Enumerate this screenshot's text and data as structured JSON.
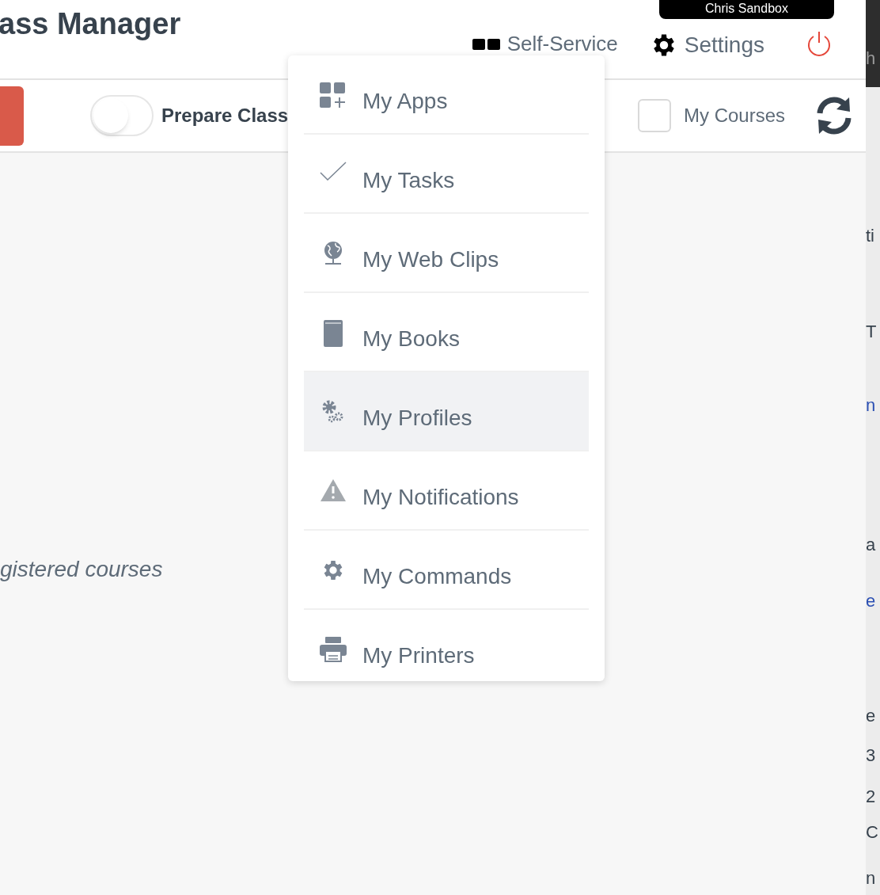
{
  "header": {
    "title": "ass Manager",
    "account_badge": "Chris Sandbox",
    "self_service": "Self-Service",
    "settings": "Settings"
  },
  "toolbar": {
    "prepare_class": {
      "label": "Prepare Class",
      "on": false
    },
    "my_courses": {
      "label": "My Courses",
      "checked": false
    }
  },
  "content": {
    "message": "gistered courses"
  },
  "menu": [
    {
      "kind": "apps",
      "label": "My Apps",
      "selected": false
    },
    {
      "kind": "tasks",
      "label": "My Tasks",
      "selected": false
    },
    {
      "kind": "webclips",
      "label": "My Web Clips",
      "selected": false
    },
    {
      "kind": "books",
      "label": "My Books",
      "selected": false
    },
    {
      "kind": "profiles",
      "label": "My Profiles",
      "selected": true
    },
    {
      "kind": "notifications",
      "label": "My Notifications",
      "selected": false
    },
    {
      "kind": "commands",
      "label": "My Commands",
      "selected": false
    },
    {
      "kind": "printers",
      "label": "My Printers",
      "selected": false
    }
  ],
  "side_window": [
    {
      "text": "h",
      "kind": "dark"
    },
    {
      "text": "ti",
      "kind": "text"
    },
    {
      "text": "T",
      "kind": "text"
    },
    {
      "text": "n",
      "kind": "link"
    },
    {
      "text": "a",
      "kind": "text"
    },
    {
      "text": "e",
      "kind": "link"
    },
    {
      "text": "e",
      "kind": "text"
    },
    {
      "text": "3",
      "kind": "text"
    },
    {
      "text": "2",
      "kind": "text"
    },
    {
      "text": "C",
      "kind": "text"
    },
    {
      "text": "n",
      "kind": "text"
    }
  ]
}
